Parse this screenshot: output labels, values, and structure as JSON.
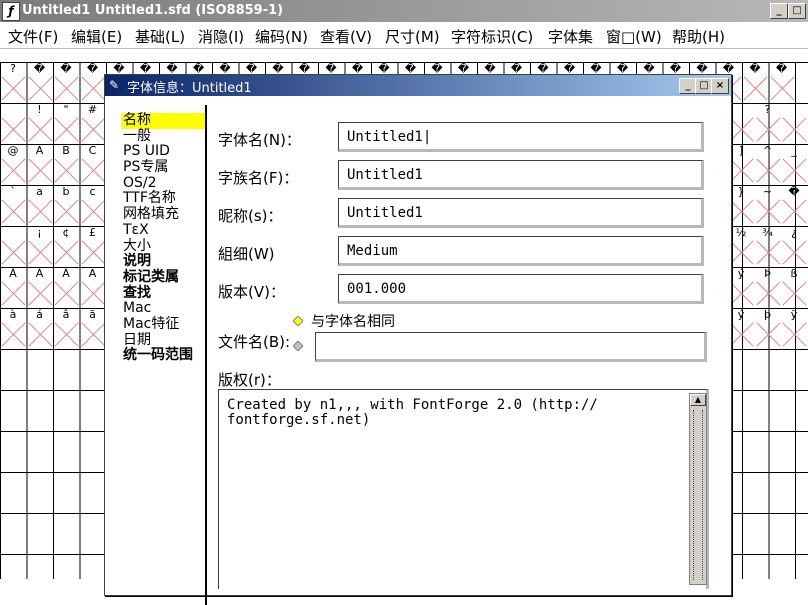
{
  "window": {
    "title": "Untitled1  Untitled1.sfd (ISO8859-1)",
    "controls": {
      "minimize": "_",
      "maximize": "□",
      "close": "×"
    }
  },
  "menu": [
    {
      "label": "文件(F)"
    },
    {
      "label": "编辑(E)"
    },
    {
      "label": "基础(L)"
    },
    {
      "label": "消隐(I)"
    },
    {
      "label": "编码(N)"
    },
    {
      "label": "查看(V)"
    },
    {
      "label": "尺寸(M)"
    },
    {
      "label": "字符标识(C)"
    },
    {
      "label": "字体集"
    },
    {
      "label": "窗□(W)"
    },
    {
      "label": "帮助(H)"
    }
  ],
  "grid_glyphs": {
    "row1": [
      "?",
      "�",
      "�",
      "�",
      "�",
      "�",
      "�",
      "�",
      "�",
      "�",
      "�",
      "�",
      "�",
      "�",
      "�",
      "�",
      "�",
      "�",
      "�",
      "�",
      "�",
      "�",
      "�",
      "�",
      "�",
      "�",
      "�",
      "�",
      "�",
      "�"
    ],
    "left_rows": [
      [
        "",
        "!",
        "\"",
        "#"
      ],
      [
        "@",
        "A",
        "B",
        "C"
      ],
      [
        "`",
        "a",
        "b",
        "c"
      ],
      [
        "",
        "¡",
        "¢",
        "£"
      ],
      [
        "À",
        "Á",
        "Â",
        "Ã"
      ],
      [
        "à",
        "á",
        "â",
        "ã"
      ]
    ],
    "right_rows": [
      [
        "",
        "?",
        ""
      ],
      [
        "]",
        "^",
        "_"
      ],
      [
        "}",
        "~",
        "�"
      ],
      [
        "½",
        "¾",
        "¿"
      ],
      [
        "ý",
        "Þ",
        "ß"
      ],
      [
        "ý",
        "þ",
        "ÿ"
      ]
    ]
  },
  "dialog": {
    "title": "字体信息：Untitled1",
    "sidebar": [
      {
        "label": "名称",
        "selected": true
      },
      {
        "label": "一般"
      },
      {
        "label": "PS UID"
      },
      {
        "label": "PS专属"
      },
      {
        "label": "OS/2"
      },
      {
        "label": "TTF名称"
      },
      {
        "label": "网格填充"
      },
      {
        "label": "TεX"
      },
      {
        "label": "大小"
      },
      {
        "label": "说明"
      },
      {
        "label": "标记类属"
      },
      {
        "label": "查找"
      },
      {
        "label": "Mac"
      },
      {
        "label": "Mac特征"
      },
      {
        "label": "日期"
      },
      {
        "label": "统一码范围"
      }
    ],
    "fields": {
      "fontname_label": "字体名(N)：",
      "fontname_value": "Untitled1|",
      "family_label": "字族名(F)：",
      "family_value": "Untitled1",
      "nickname_label": "昵称(s)：",
      "nickname_value": "Untitled1",
      "weight_label": "組细(W)",
      "weight_value": "Medium",
      "version_label": "版本(V)：",
      "version_value": "001.000",
      "filename_label": "文件名(B):",
      "filename_same_option": "与字体名相同",
      "filename_value": "",
      "copyright_label": "版权(r)：",
      "copyright_value": "Created by n1,,, with FontForge 2.0 (http://\nfontforge.sf.net)"
    }
  }
}
